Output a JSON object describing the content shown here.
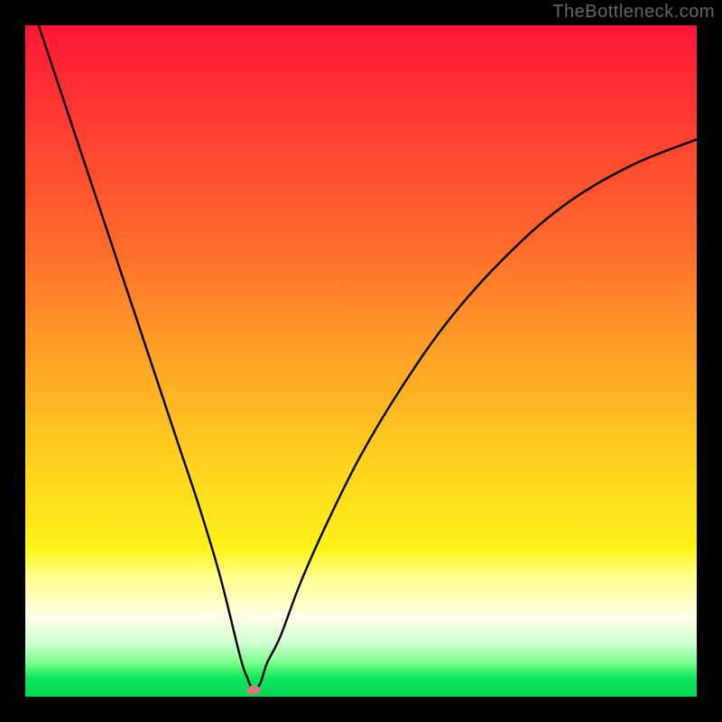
{
  "watermark": "TheBottleneck.com",
  "marker": {
    "color": "#d87a78"
  },
  "chart_data": {
    "type": "line",
    "title": "",
    "xlabel": "",
    "ylabel": "",
    "xlim": [
      0,
      100
    ],
    "ylim": [
      0,
      100
    ],
    "grid": false,
    "legend": false,
    "minimum_x": 34,
    "series": [
      {
        "name": "bottleneck-curve",
        "x": [
          2,
          5,
          8,
          11,
          14,
          17,
          20,
          23,
          26,
          29,
          32,
          33,
          34,
          35,
          36,
          38,
          41,
          45,
          50,
          56,
          63,
          71,
          80,
          90,
          100
        ],
        "values": [
          100,
          91,
          82,
          73,
          64,
          55,
          46,
          37,
          28,
          18,
          6,
          3,
          1,
          2,
          5,
          9,
          17,
          26,
          36,
          46,
          56,
          65,
          73,
          79,
          83
        ]
      }
    ],
    "marker_point": {
      "x": 34,
      "y": 1
    }
  }
}
